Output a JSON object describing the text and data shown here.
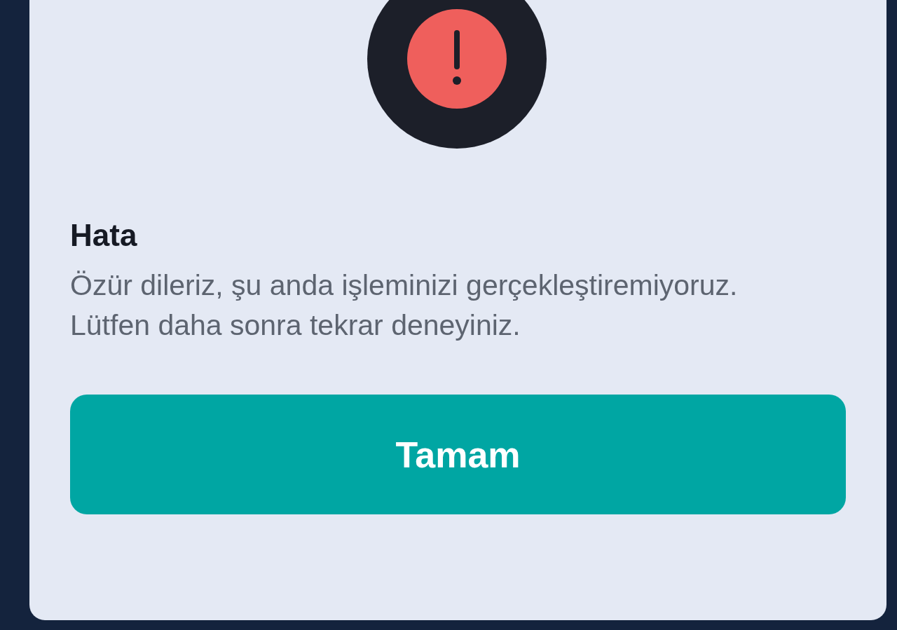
{
  "dialog": {
    "title": "Hata",
    "message": "Özür dileriz, şu anda işleminizi gerçekleştiremiyoruz. Lütfen daha sonra tekrar deneyiniz.",
    "buttons": [
      {
        "label": "Tamam",
        "kind": "primary"
      }
    ]
  }
}
